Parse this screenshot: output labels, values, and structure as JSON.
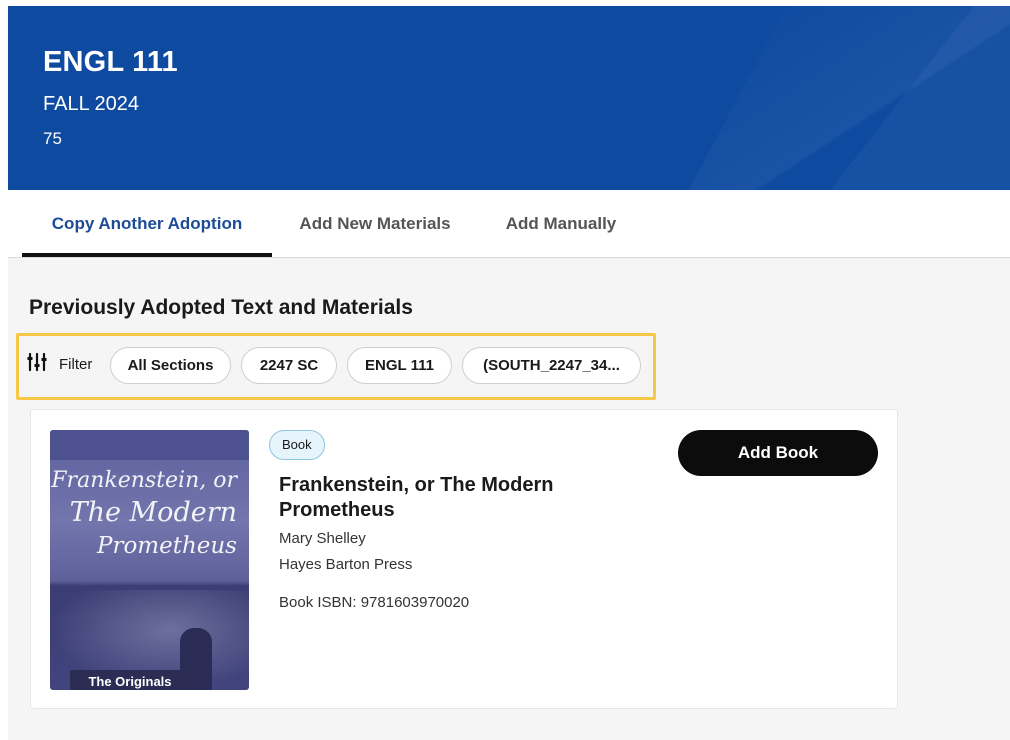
{
  "header": {
    "course_code": "ENGL 111",
    "term": "FALL 2024",
    "section": "75",
    "background_color": "#0e4aa0"
  },
  "tabs": [
    {
      "label": "Copy Another Adoption",
      "active": true
    },
    {
      "label": "Add New Materials",
      "active": false
    },
    {
      "label": "Add Manually",
      "active": false
    }
  ],
  "main": {
    "heading": "Previously Adopted Text and Materials",
    "filter": {
      "icon": "sliders-icon",
      "label": "Filter",
      "chips": [
        "All Sections",
        "2247 SC",
        "ENGL 111",
        "(SOUTH_2247_34..."
      ]
    },
    "book": {
      "type_badge": "Book",
      "title": "Frankenstein, or The Modern Prometheus",
      "author": "Mary Shelley",
      "publisher": "Hayes Barton Press",
      "isbn": "Book ISBN: 9781603970020",
      "add_button_label": "Add Book",
      "cover": {
        "title_lines": [
          "Frankenstein, or",
          "The Modern",
          "Prometheus"
        ],
        "series": "The Originals"
      }
    }
  },
  "colors": {
    "accent_tab": "#1c4c96",
    "highlight_border": "#f7c845",
    "button_bg": "#0c0c0c"
  }
}
